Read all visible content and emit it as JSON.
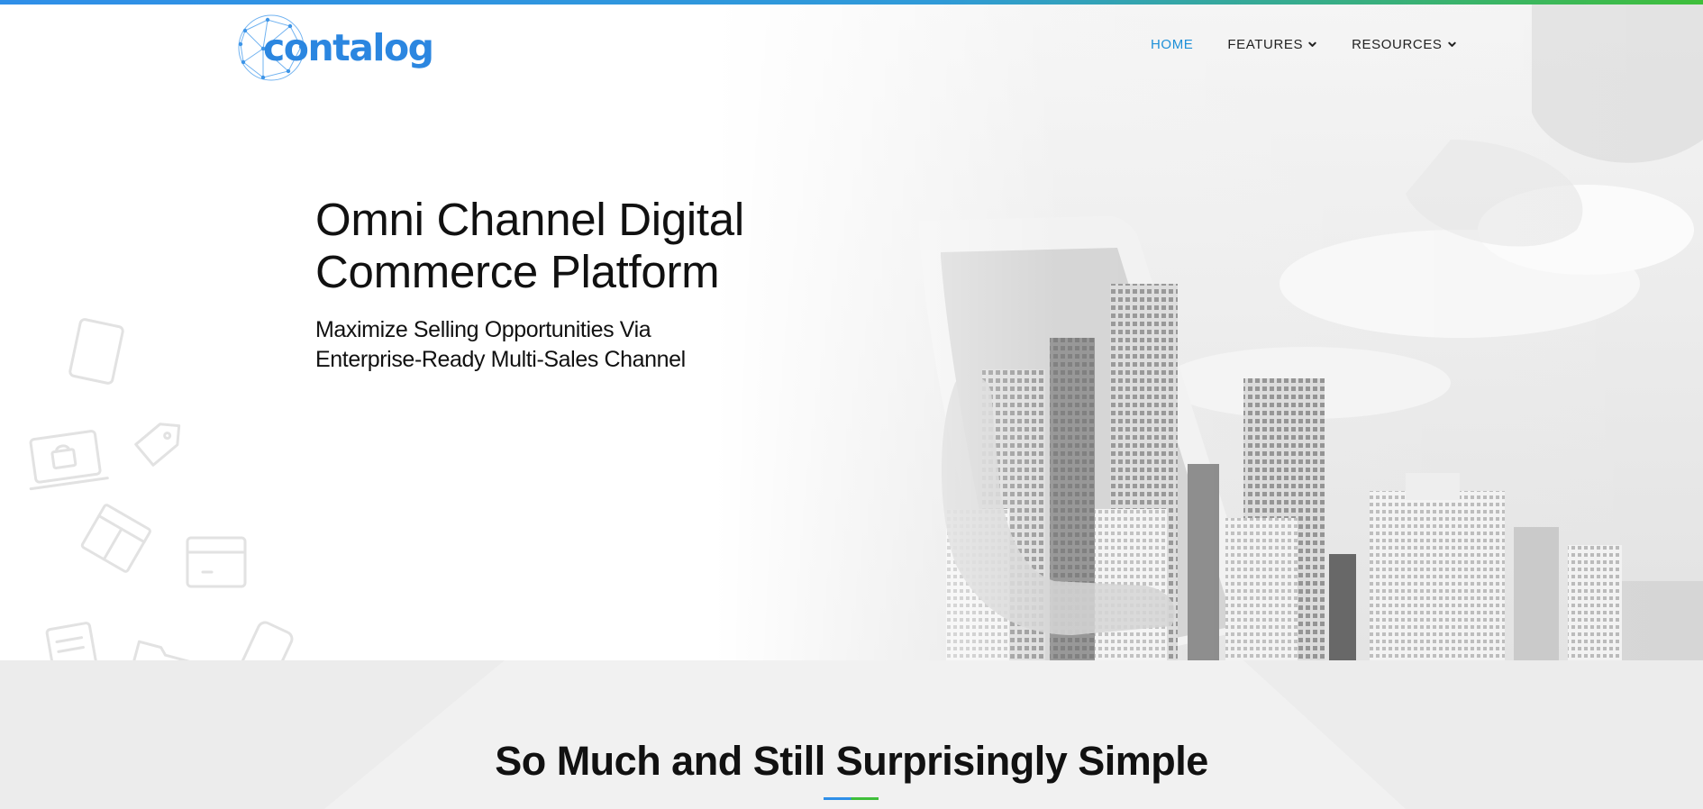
{
  "brand": {
    "logo_text": "contalog",
    "logo_color": "#2b86e0"
  },
  "accent_colors": {
    "blue": "#2f8fe8",
    "green": "#3fbf3a",
    "nav_active": "#1e90d8"
  },
  "nav": {
    "items": [
      {
        "label": "HOME",
        "active": true,
        "has_dropdown": false
      },
      {
        "label": "FEATURES",
        "active": false,
        "has_dropdown": true,
        "icon": "chevron-down-icon"
      },
      {
        "label": "RESOURCES",
        "active": false,
        "has_dropdown": true,
        "icon": "chevron-down-icon"
      }
    ]
  },
  "hero": {
    "title_line1": "Omni Channel Digital",
    "title_line2": "Commerce Platform",
    "subtitle_line1": "Maximize Selling Opportunities Via",
    "subtitle_line2": "Enterprise-Ready Multi-Sales Channel",
    "decorative_icons": [
      "tablet-icon",
      "laptop-bag-icon",
      "price-tag-icon",
      "store-icon",
      "box-icon",
      "clipboard-icon",
      "folder-icon",
      "phone-icon"
    ],
    "image_subject": "hand-holding-tablet-with-city-skyline"
  },
  "features_section": {
    "title": "So Much and Still Surprisingly Simple"
  }
}
